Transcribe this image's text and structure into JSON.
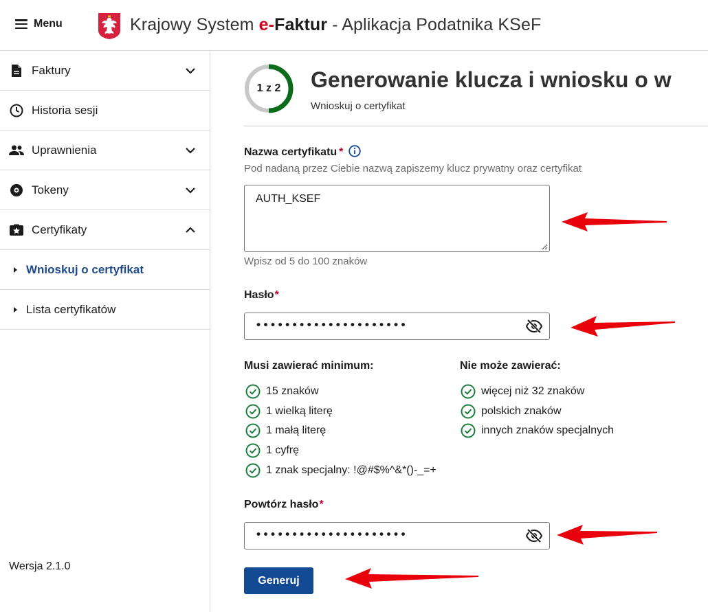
{
  "header": {
    "menu_label": "Menu",
    "title_prefix": "Krajowy System ",
    "title_e": "e-",
    "title_faktur": "Faktur",
    "title_suffix": " - Aplikacja Podatnika KSeF"
  },
  "sidebar": {
    "items": [
      {
        "label": "Faktury",
        "icon": "document-icon",
        "expandable": true,
        "expanded": false
      },
      {
        "label": "Historia sesji",
        "icon": "clock-icon",
        "expandable": false
      },
      {
        "label": "Uprawnienia",
        "icon": "people-icon",
        "expandable": true,
        "expanded": false
      },
      {
        "label": "Tokeny",
        "icon": "token-icon",
        "expandable": true,
        "expanded": false
      },
      {
        "label": "Certyfikaty",
        "icon": "certificate-star-icon",
        "expandable": true,
        "expanded": true
      }
    ],
    "sub_items": [
      {
        "label": "Wnioskuj o certyfikat",
        "active": true
      },
      {
        "label": "Lista certyfikatów",
        "active": false
      }
    ],
    "version": "Wersja 2.1.0"
  },
  "main": {
    "step": "1 z 2",
    "step_progress": 0.5,
    "title": "Generowanie klucza i wniosku o w",
    "subtitle": "Wnioskuj o certyfikat",
    "cert_name": {
      "label": "Nazwa certyfikatu",
      "required_mark": "*",
      "hint": "Pod nadaną przez Ciebie nazwą zapiszemy klucz prywatny oraz certyfikat",
      "value": "AUTH_KSEF",
      "length_hint": "Wpisz od 5 do 100 znaków"
    },
    "password": {
      "label": "Hasło",
      "required_mark": "*",
      "value_masked": "•••••••••••••••••••••"
    },
    "must_contain": {
      "title": "Musi zawierać minimum:",
      "rules": [
        "15 znaków",
        "1 wielką literę",
        "1 małą literę",
        "1 cyfrę",
        "1 znak specjalny: !@#$%^&*()-_=+"
      ]
    },
    "must_not_contain": {
      "title": "Nie może zawierać:",
      "rules": [
        "więcej niż 32 znaków",
        "polskich znaków",
        "innych znaków specjalnych"
      ]
    },
    "repeat_password": {
      "label": "Powtórz hasło",
      "required_mark": "*",
      "value_masked": "•••••••••••••••••••••"
    },
    "submit_label": "Generuj"
  },
  "colors": {
    "brand_blue": "#124a94",
    "active_nav": "#1e4b8e",
    "required": "#c2002f",
    "check_green": "#1a7f3c",
    "progress_green": "#0b6b1a",
    "arrow_red": "#e8000b"
  }
}
